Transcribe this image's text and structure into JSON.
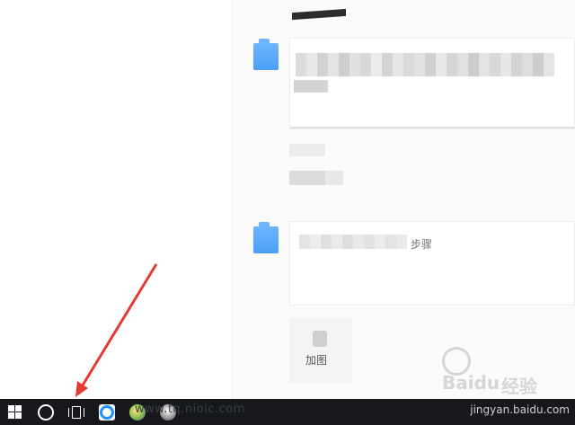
{
  "window": {
    "card_add_label": "加图",
    "card_item_suffix": "步骤"
  },
  "taskbar": {
    "start_label": "Start",
    "url_text": "www.tq.nioic.com",
    "colors": {
      "taskbar_bg": "#16181c",
      "edge_blue": "#1e90ff"
    }
  },
  "watermark": {
    "site": "jingyan.baidu.com",
    "brand_cn": "经验",
    "brand_en": "Baidu"
  },
  "annotation": {
    "arrow_color": "#e53935"
  }
}
